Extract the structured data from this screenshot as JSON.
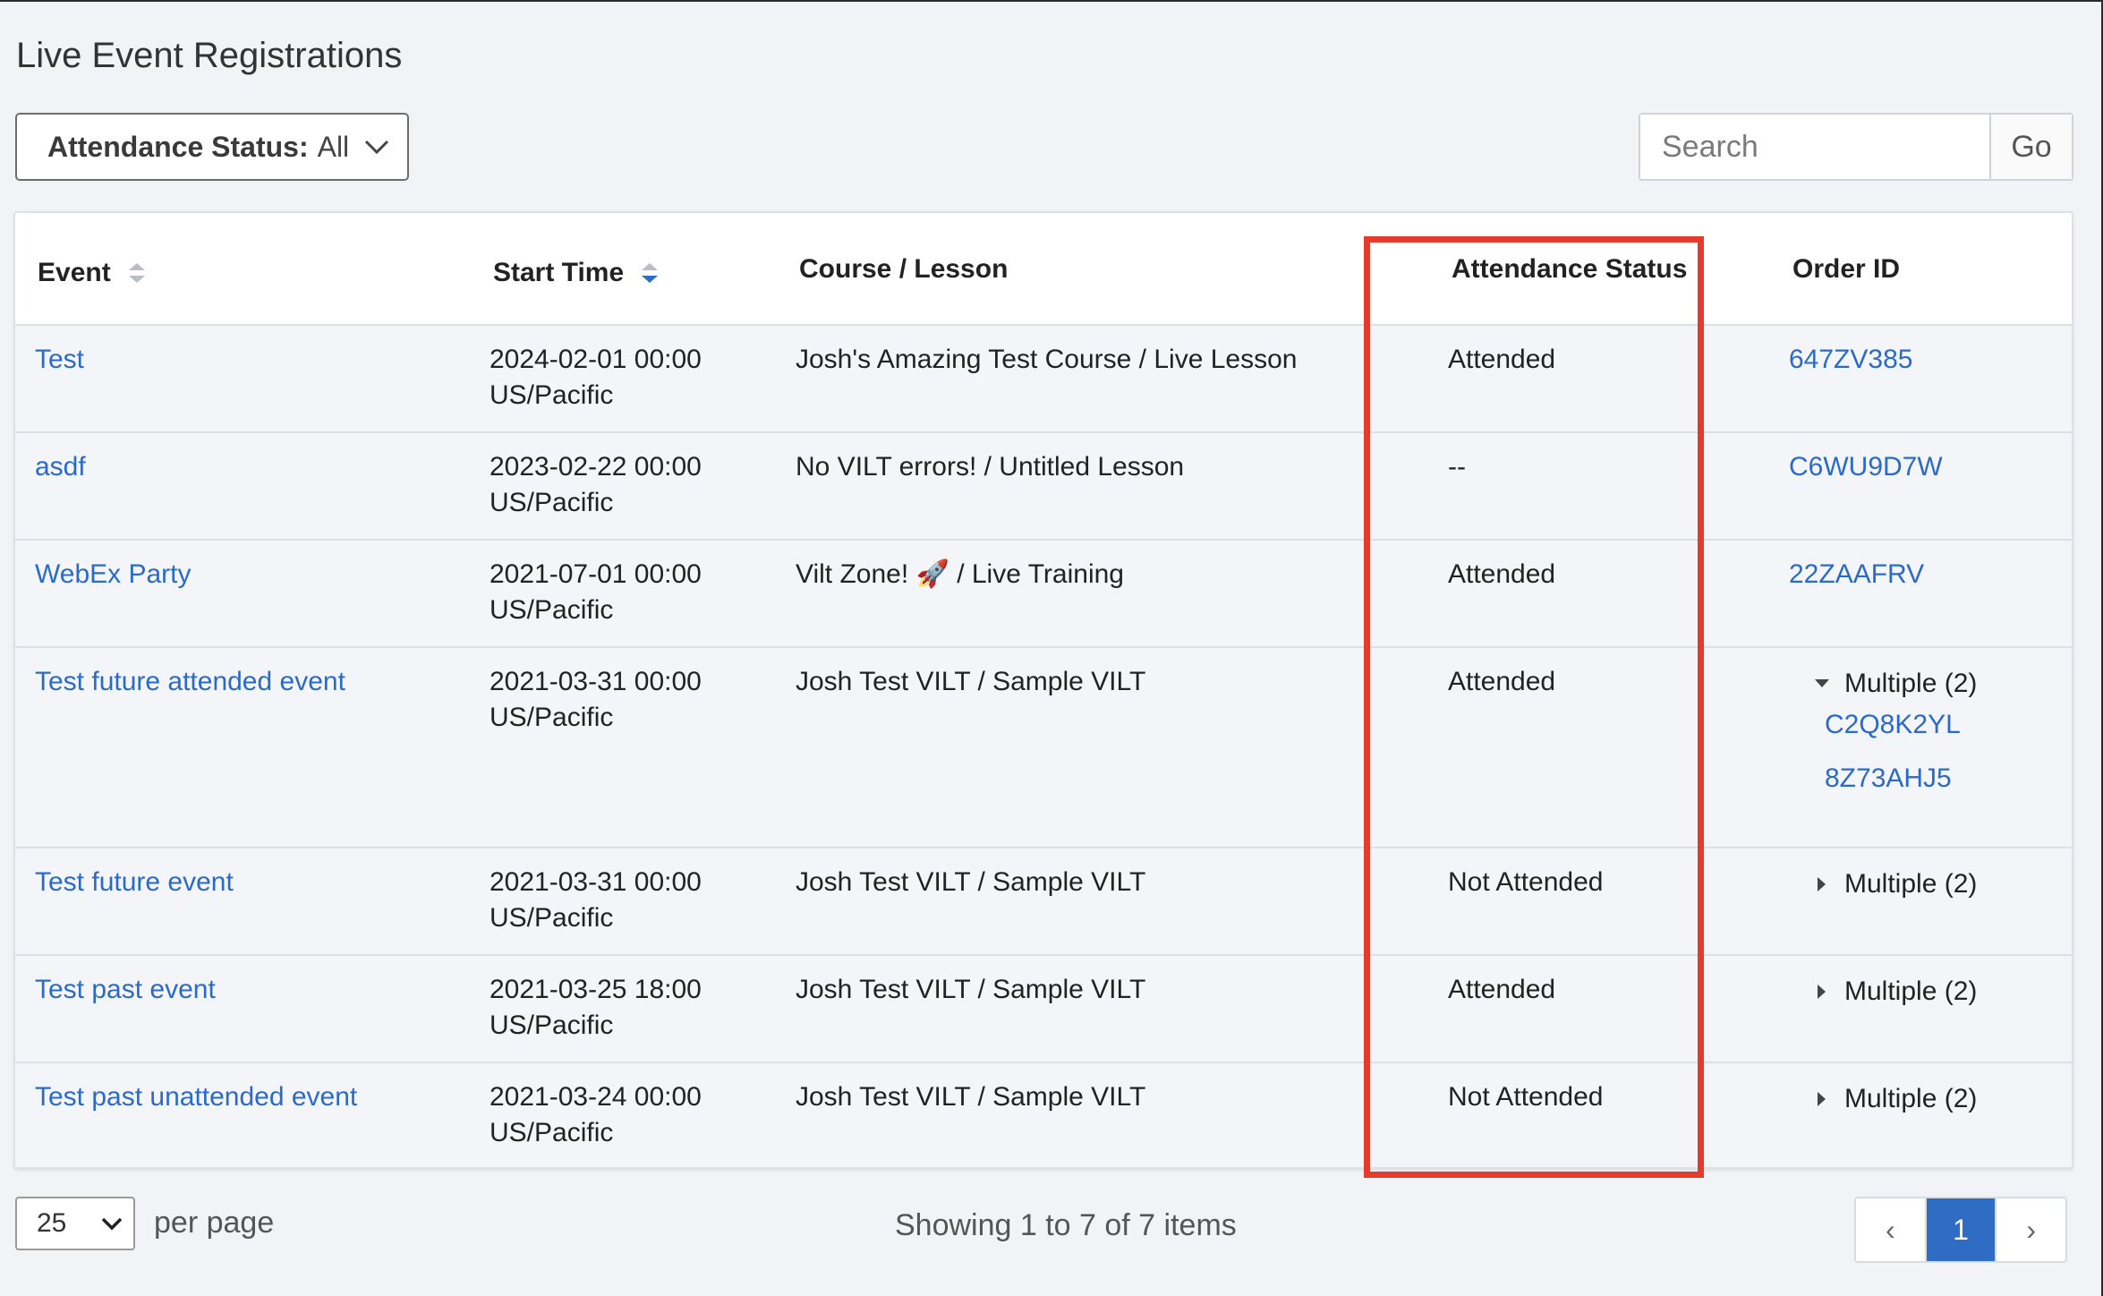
{
  "page": {
    "title": "Live Event Registrations"
  },
  "filter": {
    "label": "Attendance Status:",
    "value": "All"
  },
  "search": {
    "placeholder": "Search",
    "go_label": "Go"
  },
  "table": {
    "columns": {
      "event": "Event",
      "start_time": "Start Time",
      "course_lesson": "Course / Lesson",
      "attendance_status": "Attendance Status",
      "order_id": "Order ID"
    },
    "rows": [
      {
        "event": "Test",
        "start_date": "2024-02-01 00:00",
        "timezone": "US/Pacific",
        "course_lesson": "Josh's Amazing Test Course / Live Lesson",
        "attendance": "Attended",
        "order_id": "647ZV385"
      },
      {
        "event": "asdf",
        "start_date": "2023-02-22 00:00",
        "timezone": "US/Pacific",
        "course_lesson": "No VILT errors! / Untitled Lesson",
        "attendance": "--",
        "order_id": "C6WU9D7W"
      },
      {
        "event": "WebEx Party",
        "start_date": "2021-07-01 00:00",
        "timezone": "US/Pacific",
        "course_lesson": "Vilt Zone! 🚀 / Live Training",
        "attendance": "Attended",
        "order_id": "22ZAAFRV"
      },
      {
        "event": "Test future attended event",
        "start_date": "2021-03-31 00:00",
        "timezone": "US/Pacific",
        "course_lesson": "Josh Test VILT / Sample VILT",
        "attendance": "Attended",
        "order_multi": "Multiple (2)",
        "order_ids": [
          "C2Q8K2YL",
          "8Z73AHJ5"
        ]
      },
      {
        "event": "Test future event",
        "start_date": "2021-03-31 00:00",
        "timezone": "US/Pacific",
        "course_lesson": "Josh Test VILT / Sample VILT",
        "attendance": "Not Attended",
        "order_multi": "Multiple (2)"
      },
      {
        "event": "Test past event",
        "start_date": "2021-03-25 18:00",
        "timezone": "US/Pacific",
        "course_lesson": "Josh Test VILT / Sample VILT",
        "attendance": "Attended",
        "order_multi": "Multiple (2)"
      },
      {
        "event": "Test past unattended event",
        "start_date": "2021-03-24 00:00",
        "timezone": "US/Pacific",
        "course_lesson": "Josh Test VILT / Sample VILT",
        "attendance": "Not Attended",
        "order_multi": "Multiple (2)"
      }
    ]
  },
  "footer": {
    "per_page_value": "25",
    "per_page_label": "per page",
    "showing": "Showing 1 to 7 of 7 items",
    "pager": {
      "prev": "‹",
      "current": "1",
      "next": "›"
    }
  },
  "colors": {
    "link": "#2b6bc7",
    "highlight": "#e53b2c",
    "pager_active": "#2f6dc4"
  }
}
